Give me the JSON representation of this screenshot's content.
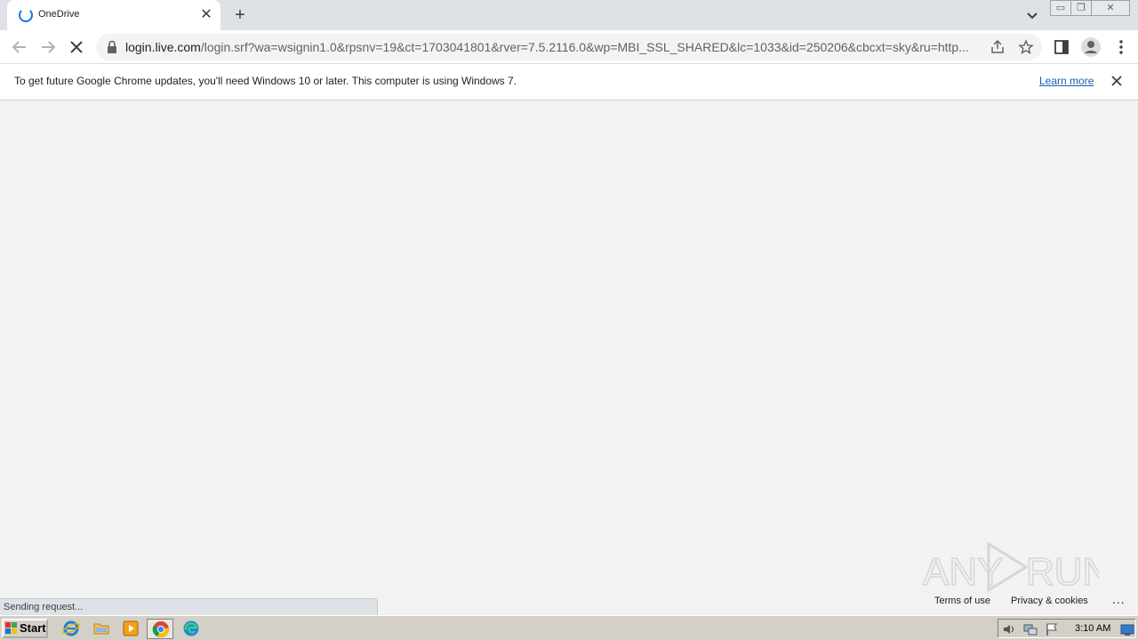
{
  "browser": {
    "tab": {
      "title": "OneDrive",
      "close_glyph": "✕"
    },
    "new_tab_glyph": "+",
    "address": {
      "host": "login.live.com",
      "path": "/login.srf?wa=wsignin1.0&rpsnv=19&ct=1703041801&rver=7.5.2116.0&wp=MBI_SSL_SHARED&lc=1033&id=250206&cbcxt=sky&ru=http..."
    },
    "window_buttons": {
      "minimize": "▭",
      "restore": "❐",
      "close": "✕"
    },
    "icons": [
      "tab-spinner-icon",
      "back-arrow-icon",
      "forward-arrow-icon",
      "stop-loading-icon",
      "lock-icon",
      "share-icon",
      "star-icon",
      "side-panel-icon",
      "profile-icon",
      "kebab-menu-icon"
    ]
  },
  "infobar": {
    "message": "To get future Google Chrome updates, you'll need Windows 10 or later. This computer is using Windows 7.",
    "link": "Learn more"
  },
  "page": {
    "watermark": "ANY RUN",
    "footer": {
      "terms": "Terms of use",
      "privacy": "Privacy & cookies",
      "more": "..."
    },
    "status": "Sending request..."
  },
  "taskbar": {
    "start_label": "Start",
    "clock": "3:10 AM",
    "icons": [
      "ie-icon",
      "explorer-folder-icon",
      "media-player-icon",
      "chrome-icon",
      "edge-icon"
    ],
    "tray_icons": [
      "volume-icon",
      "network-icon",
      "action-center-flag-icon",
      "show-desktop-icon"
    ]
  },
  "colors": {
    "accent": "#1a73e8",
    "link": "#1a5fb4",
    "tabstrip": "#dee1e6",
    "page_bg": "#f2f2f2",
    "taskbar": "#d4d0c8"
  }
}
